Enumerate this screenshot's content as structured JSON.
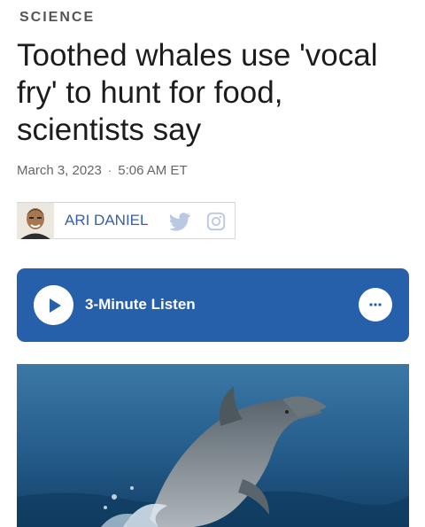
{
  "section": {
    "label": "SCIENCE"
  },
  "article": {
    "headline": "Toothed whales use 'vocal fry' to hunt for food, scientists say",
    "date": "March 3, 2023",
    "separator": "·",
    "time": "5:06 AM ET"
  },
  "byline": {
    "author": "ARI DANIEL",
    "icons": [
      "avatar-photo",
      "twitter-icon",
      "instagram-icon"
    ]
  },
  "player": {
    "listen_label": "3-Minute Listen",
    "icons": [
      "play-icon",
      "more-options-icon"
    ]
  },
  "colors": {
    "player_background": "#265faa",
    "author_link": "#3a5fa6",
    "social_icon": "#b9c8e3"
  }
}
